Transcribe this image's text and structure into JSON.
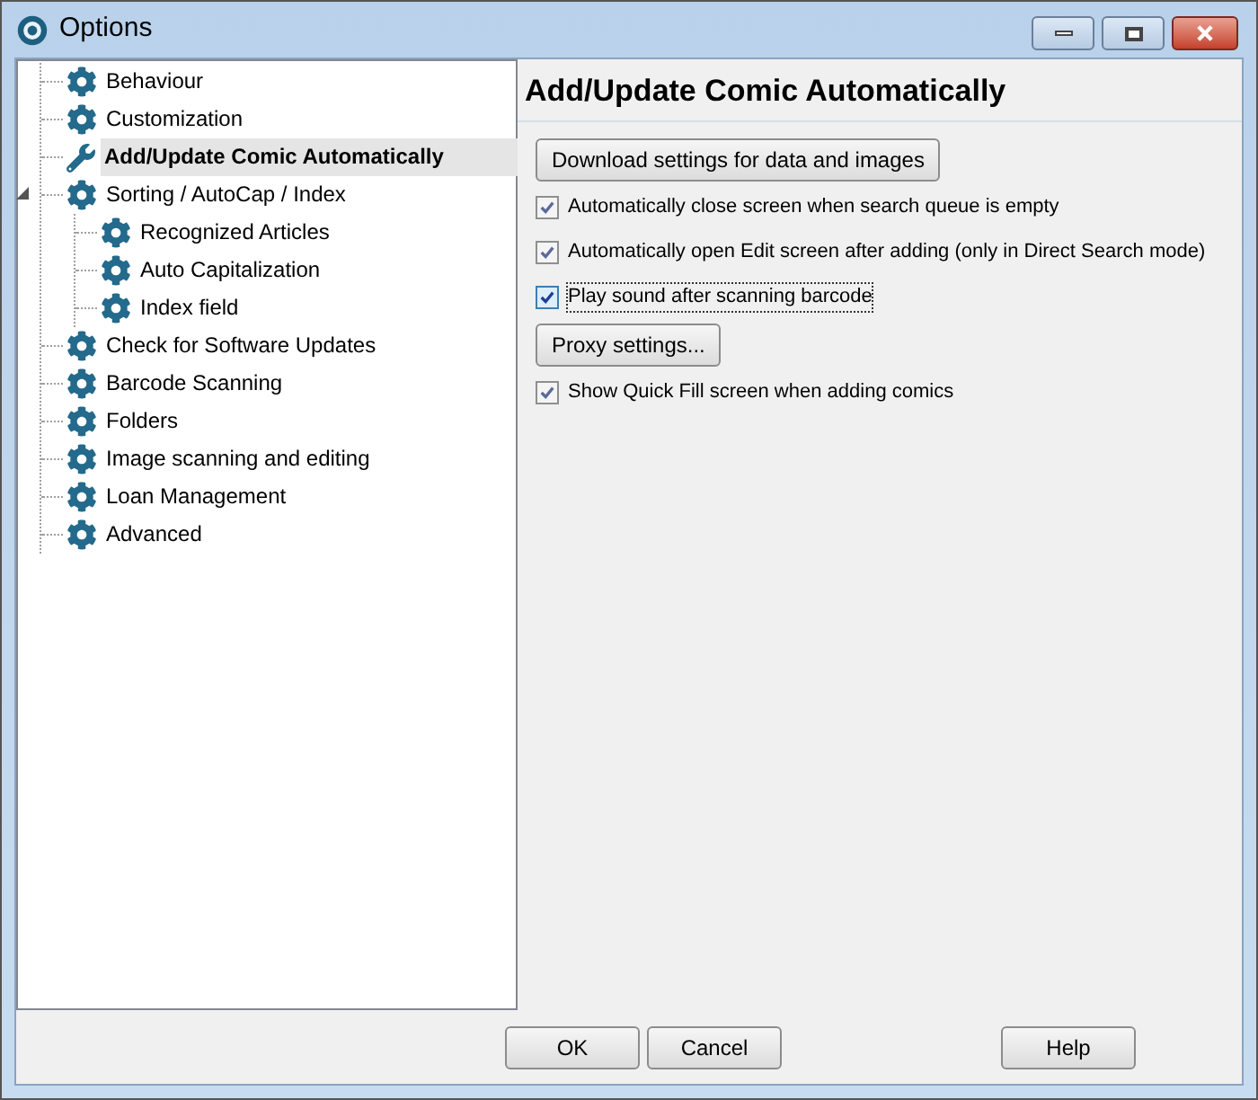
{
  "window": {
    "title": "Options"
  },
  "tree": [
    {
      "label": "Behaviour",
      "kind": "gear",
      "selected": false
    },
    {
      "label": "Customization",
      "kind": "gear",
      "selected": false
    },
    {
      "label": "Add/Update Comic Automatically",
      "kind": "wrench",
      "selected": true
    },
    {
      "label": "Sorting / AutoCap / Index",
      "kind": "gear",
      "selected": false,
      "expanded": true,
      "children": [
        {
          "label": "Recognized Articles",
          "kind": "gear",
          "selected": false
        },
        {
          "label": "Auto Capitalization",
          "kind": "gear",
          "selected": false
        },
        {
          "label": "Index field",
          "kind": "gear",
          "selected": false
        }
      ]
    },
    {
      "label": "Check for Software Updates",
      "kind": "gear",
      "selected": false
    },
    {
      "label": "Barcode Scanning",
      "kind": "gear",
      "selected": false
    },
    {
      "label": "Folders",
      "kind": "gear",
      "selected": false
    },
    {
      "label": "Image scanning and editing",
      "kind": "gear",
      "selected": false
    },
    {
      "label": "Loan Management",
      "kind": "gear",
      "selected": false
    },
    {
      "label": "Advanced",
      "kind": "gear",
      "selected": false
    }
  ],
  "panel": {
    "title": "Add/Update Comic Automatically",
    "items": [
      {
        "kind": "button",
        "label": "Download settings for data and images"
      },
      {
        "kind": "checkbox",
        "label": "Automatically close screen when search queue is empty",
        "checked": true,
        "focused": false
      },
      {
        "kind": "checkbox",
        "label": "Automatically open Edit screen after adding (only in Direct Search mode)",
        "checked": true,
        "focused": false
      },
      {
        "kind": "checkbox",
        "label": "Play sound after scanning barcode",
        "checked": true,
        "focused": true
      },
      {
        "kind": "button",
        "label": "Proxy settings..."
      },
      {
        "kind": "checkbox",
        "label": "Show Quick Fill screen when adding comics",
        "checked": true,
        "focused": false
      }
    ]
  },
  "footer": {
    "buttons": [
      {
        "label": "OK",
        "kind": "left"
      },
      {
        "label": "Cancel",
        "kind": "left"
      },
      {
        "label": "Help",
        "kind": "right"
      }
    ]
  }
}
